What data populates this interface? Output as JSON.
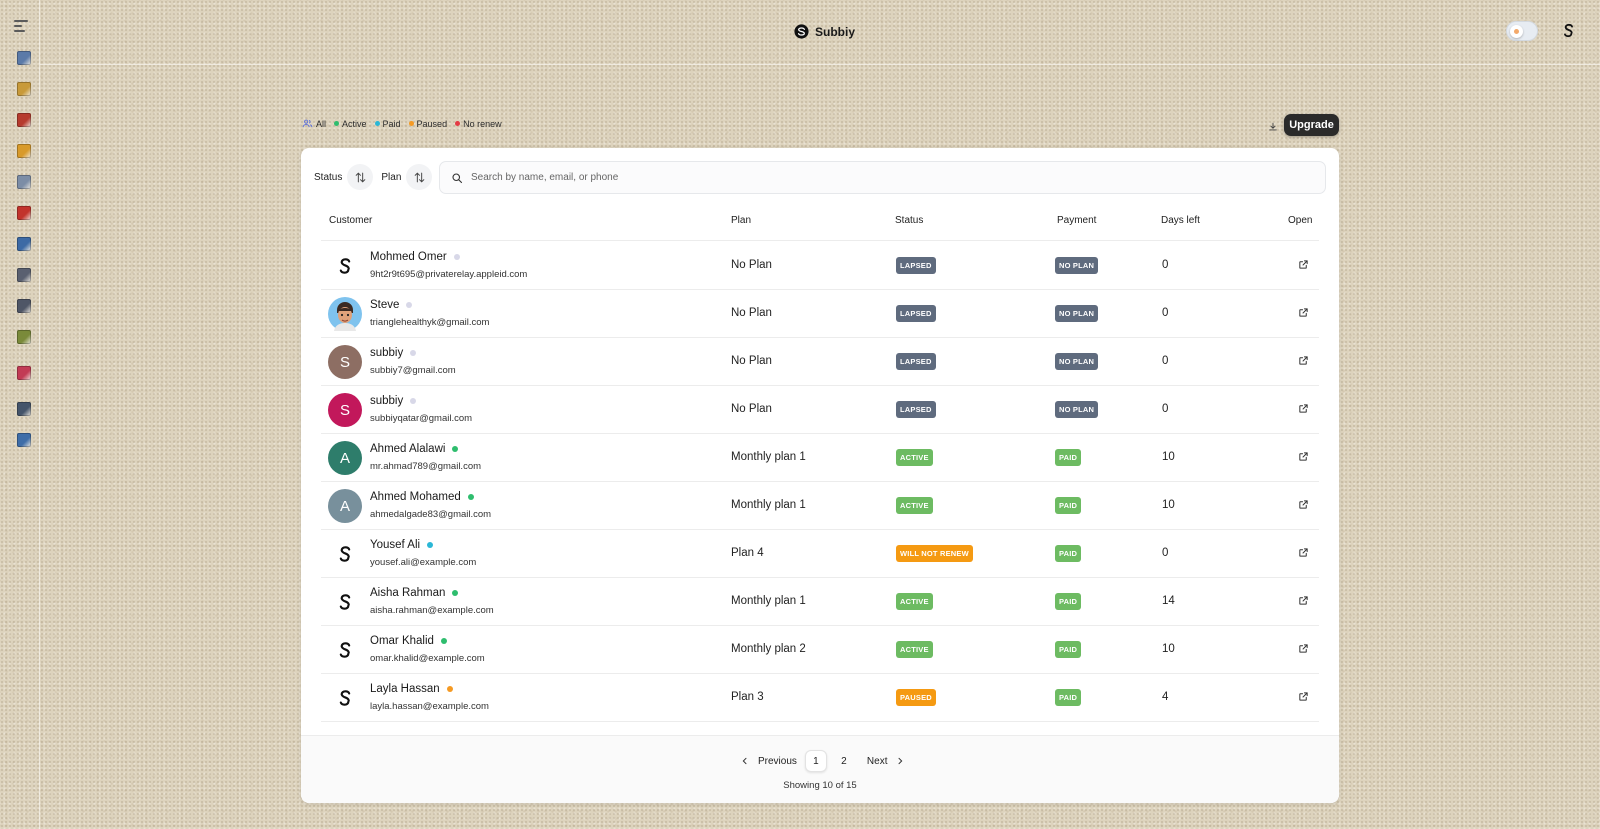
{
  "app": {
    "brand": "Subbiy"
  },
  "sidebar": {
    "icons": [
      {
        "name": "buildings-icon",
        "color": "#5b7aa8"
      },
      {
        "name": "document-icon",
        "color": "#c89a3a"
      },
      {
        "name": "book-icon",
        "color": "#b63b2e"
      },
      {
        "name": "folder-icon",
        "color": "#d89a2a"
      },
      {
        "name": "page-icon",
        "color": "#7c8da6"
      },
      {
        "name": "binder-icon",
        "color": "#c2332c"
      },
      {
        "name": "search-document-icon",
        "color": "#3d6aa5"
      },
      {
        "name": "calculator-icon",
        "color": "#5a6070"
      },
      {
        "name": "spreadsheet-icon",
        "color": "#4f5666"
      },
      {
        "name": "money-icon",
        "color": "#7a8a3a"
      },
      {
        "name": "shopping-bag-icon",
        "color": "#c23b55"
      },
      {
        "name": "id-card-icon",
        "color": "#44546a"
      },
      {
        "name": "support-icon",
        "color": "#3e6da8"
      }
    ]
  },
  "filters": {
    "items": [
      {
        "label": "All",
        "color": "#5b6fd8",
        "icon": "users-icon"
      },
      {
        "label": "Active",
        "color": "#2ebd6e"
      },
      {
        "label": "Paid",
        "color": "#2ab7d6"
      },
      {
        "label": "Paused",
        "color": "#f59a23"
      },
      {
        "label": "No renew",
        "color": "#e43b44"
      }
    ],
    "upgrade_label": "Upgrade"
  },
  "toolbar": {
    "status_label": "Status",
    "plan_label": "Plan",
    "search_placeholder": "Search by name, email, or phone"
  },
  "table": {
    "headers": {
      "customer": "Customer",
      "plan": "Plan",
      "status": "Status",
      "payment": "Payment",
      "days_left": "Days left",
      "open": "Open"
    },
    "rows": [
      {
        "name": "Mohmed Omer",
        "email": "9ht2r9t695@privaterelay.appleid.com",
        "avatar": "logo",
        "initial": "",
        "avatar_color": "#ffffff",
        "dot_color": "#d8d8e8",
        "plan": "No Plan",
        "status": "LAPSED",
        "status_color": "#5f6b7e",
        "payment": "NO PLAN",
        "payment_color": "#5f6b7e",
        "days": "0"
      },
      {
        "name": "Steve",
        "email": "trianglehealthyk@gmail.com",
        "avatar": "photo",
        "initial": "",
        "avatar_color": "#7fc3ee",
        "dot_color": "#d8d8e8",
        "plan": "No Plan",
        "status": "LAPSED",
        "status_color": "#5f6b7e",
        "payment": "NO PLAN",
        "payment_color": "#5f6b7e",
        "days": "0"
      },
      {
        "name": "subbiy",
        "email": "subbiy7@gmail.com",
        "avatar": "initial",
        "initial": "S",
        "avatar_color": "#8d6e63",
        "dot_color": "#d8d8e8",
        "plan": "No Plan",
        "status": "LAPSED",
        "status_color": "#5f6b7e",
        "payment": "NO PLAN",
        "payment_color": "#5f6b7e",
        "days": "0"
      },
      {
        "name": "subbiy",
        "email": "subbiyqatar@gmail.com",
        "avatar": "initial",
        "initial": "S",
        "avatar_color": "#c2185b",
        "dot_color": "#d8d8e8",
        "plan": "No Plan",
        "status": "LAPSED",
        "status_color": "#5f6b7e",
        "payment": "NO PLAN",
        "payment_color": "#5f6b7e",
        "days": "0"
      },
      {
        "name": "Ahmed Alalawi",
        "email": "mr.ahmad789@gmail.com",
        "avatar": "initial",
        "initial": "A",
        "avatar_color": "#2e7d6b",
        "dot_color": "#2ebd6e",
        "plan": "Monthly plan 1",
        "status": "ACTIVE",
        "status_color": "#6dbb62",
        "payment": "PAID",
        "payment_color": "#6dbb62",
        "days": "10"
      },
      {
        "name": "Ahmed Mohamed",
        "email": "ahmedalgade83@gmail.com",
        "avatar": "initial",
        "initial": "A",
        "avatar_color": "#78909c",
        "dot_color": "#2ebd6e",
        "plan": "Monthly plan 1",
        "status": "ACTIVE",
        "status_color": "#6dbb62",
        "payment": "PAID",
        "payment_color": "#6dbb62",
        "days": "10"
      },
      {
        "name": "Yousef Ali",
        "email": "yousef.ali@example.com",
        "avatar": "logo",
        "initial": "",
        "avatar_color": "#ffffff",
        "dot_color": "#2ab7d6",
        "plan": "Plan 4",
        "status": "WILL NOT RENEW",
        "status_color": "#f59a12",
        "payment": "PAID",
        "payment_color": "#6dbb62",
        "days": "0"
      },
      {
        "name": "Aisha Rahman",
        "email": "aisha.rahman@example.com",
        "avatar": "logo",
        "initial": "",
        "avatar_color": "#ffffff",
        "dot_color": "#2ebd6e",
        "plan": "Monthly plan 1",
        "status": "ACTIVE",
        "status_color": "#6dbb62",
        "payment": "PAID",
        "payment_color": "#6dbb62",
        "days": "14"
      },
      {
        "name": "Omar Khalid",
        "email": "omar.khalid@example.com",
        "avatar": "logo",
        "initial": "",
        "avatar_color": "#ffffff",
        "dot_color": "#2ebd6e",
        "plan": "Monthly plan 2",
        "status": "ACTIVE",
        "status_color": "#6dbb62",
        "payment": "PAID",
        "payment_color": "#6dbb62",
        "days": "10"
      },
      {
        "name": "Layla Hassan",
        "email": "layla.hassan@example.com",
        "avatar": "logo",
        "initial": "",
        "avatar_color": "#ffffff",
        "dot_color": "#f59a23",
        "plan": "Plan 3",
        "status": "PAUSED",
        "status_color": "#f59a12",
        "payment": "PAID",
        "payment_color": "#6dbb62",
        "days": "4"
      }
    ]
  },
  "pagination": {
    "previous_label": "Previous",
    "next_label": "Next",
    "pages": [
      "1",
      "2"
    ],
    "current_page": "1",
    "showing_text": "Showing 10 of 15"
  }
}
